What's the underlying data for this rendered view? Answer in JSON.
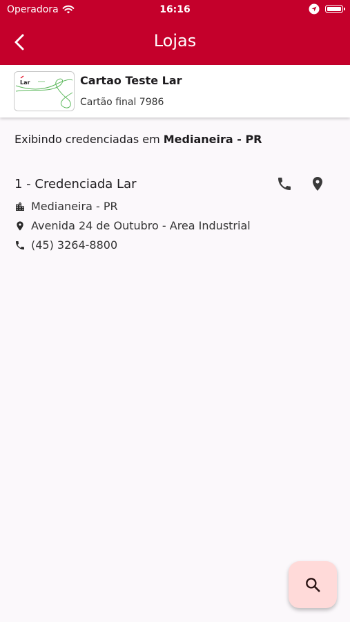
{
  "status_bar": {
    "carrier": "Operadora",
    "time": "16:16"
  },
  "app_bar": {
    "title": "Lojas",
    "back_icon": "chevron-left-icon"
  },
  "card": {
    "logo_text": "Lar",
    "name": "Cartao Teste Lar",
    "subtitle": "Cartão final 7986"
  },
  "location_notice": {
    "prefix": "Exibindo credenciadas em ",
    "city": "Medianeira - PR"
  },
  "stores": [
    {
      "title": "1 - Credenciada Lar",
      "city": "Medianeira - PR",
      "address": "Avenida 24 de Outubro - Area Industrial",
      "phone": "(45) 3264-8800"
    }
  ],
  "fab": {
    "icon": "search-icon"
  },
  "colors": {
    "primary": "#c4002b",
    "fab_bg": "#ffdad9",
    "background": "#fbf8fb"
  }
}
